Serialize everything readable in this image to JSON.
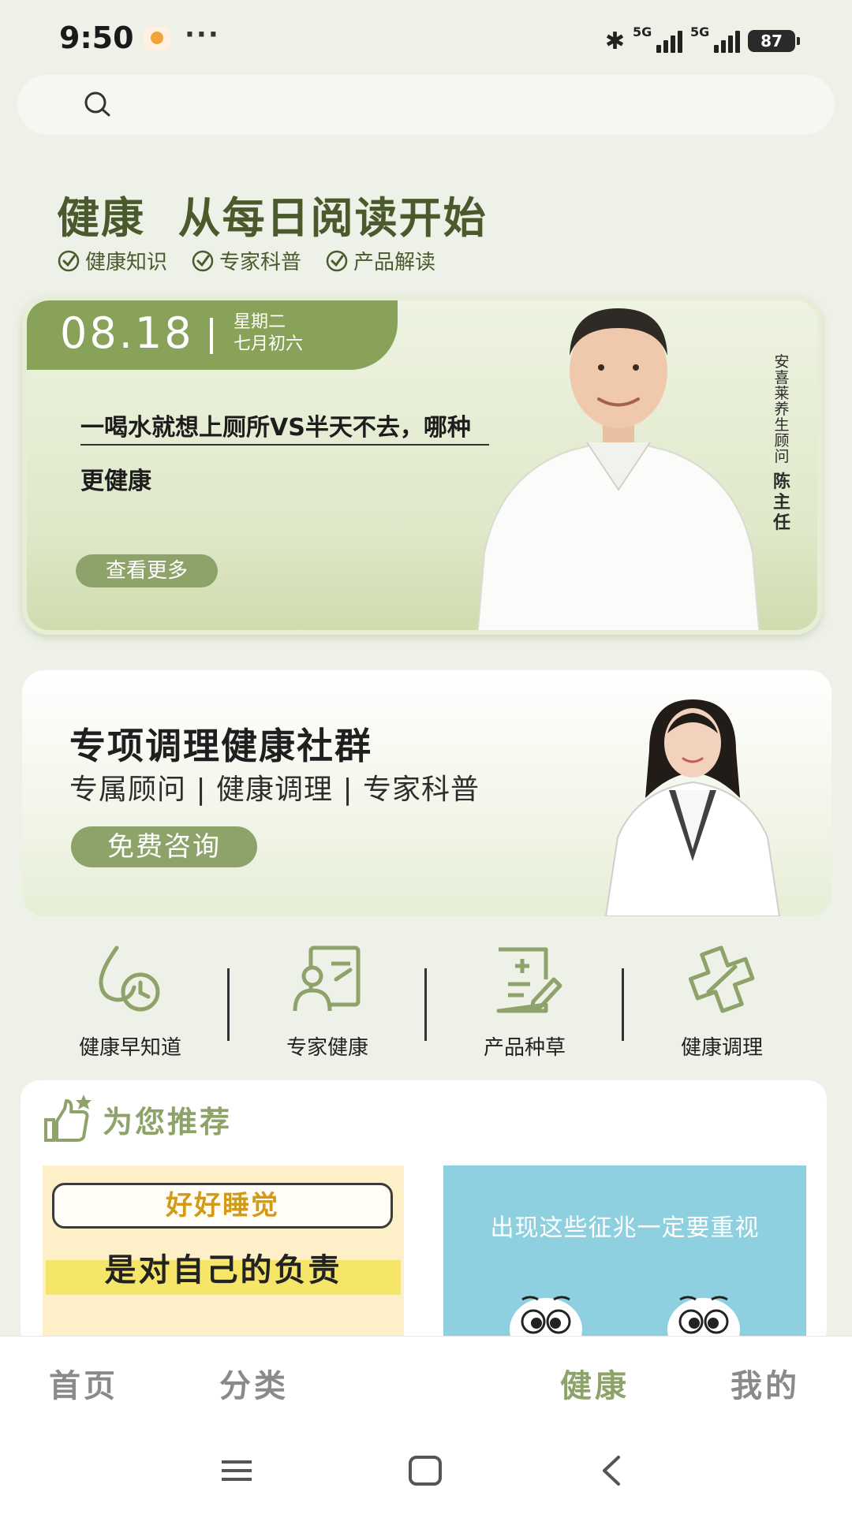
{
  "status_bar": {
    "time": "9:50",
    "more": "···",
    "network_1": "5G",
    "network_2": "5G",
    "battery": "87"
  },
  "search": {
    "icon": "search-icon"
  },
  "header": {
    "title": "健康  从每日阅读开始",
    "tags": [
      "健康知识",
      "专家科普",
      "产品解读"
    ]
  },
  "banner": {
    "date": "08.18",
    "weekday": "星期二",
    "lunar": "七月初六",
    "article_title": "一喝水就想上厕所VS半天不去，哪种更健康",
    "more_button": "查看更多",
    "doctor_caption": "安喜莱养生顾问",
    "doctor_name": "陈主任"
  },
  "community": {
    "title": "专项调理健康社群",
    "subtitle": "专属顾问 | 健康调理 | 专家科普",
    "consult_button": "免费咨询"
  },
  "categories": [
    {
      "label": "健康早知道",
      "icon": "water-clock-icon"
    },
    {
      "label": "专家健康",
      "icon": "expert-board-icon"
    },
    {
      "label": "产品种草",
      "icon": "note-plus-icon"
    },
    {
      "label": "健康调理",
      "icon": "bandage-icon"
    }
  ],
  "recommend": {
    "title": "为您推荐",
    "card_left": {
      "pill": "好好睡觉",
      "line": "是对自己的负责"
    },
    "card_right": {
      "text": "出现这些征兆一定要重视"
    }
  },
  "bottom_nav": {
    "items": [
      "首页",
      "分类",
      "健康",
      "我的"
    ],
    "active": "健康"
  },
  "colors": {
    "accent": "#8ea36a",
    "heading": "#4b5a2c",
    "background": "#eef1e8"
  }
}
